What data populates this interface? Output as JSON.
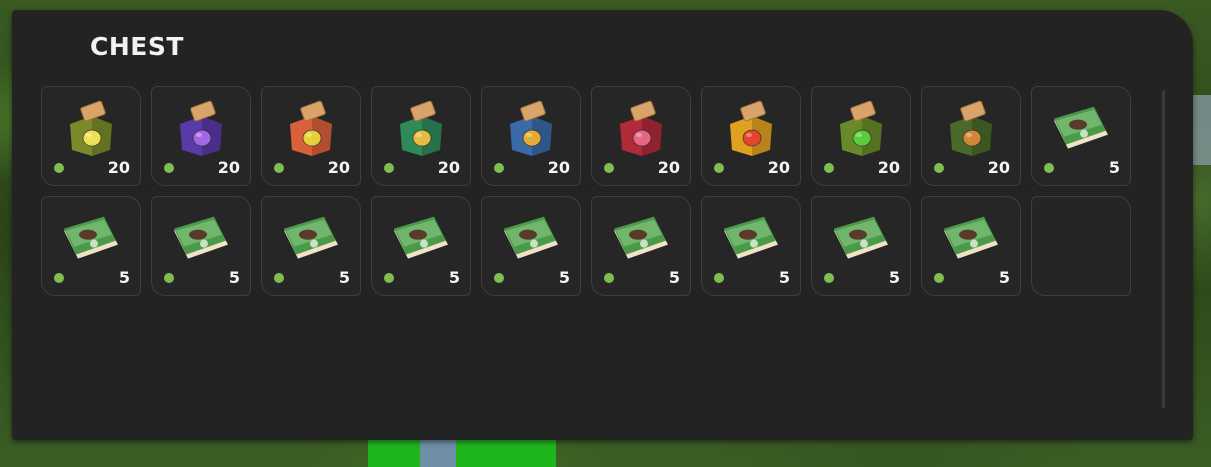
{
  "chest": {
    "title": "CHEST",
    "slots": [
      {
        "icon": "seed-bag-banana-icon",
        "color": "#7a8a2a",
        "fruit": "#f4e65a",
        "count": "20"
      },
      {
        "icon": "seed-bag-grape-icon",
        "color": "#5a3aa8",
        "fruit": "#a86ae8",
        "count": "20"
      },
      {
        "icon": "seed-bag-lemon-icon",
        "color": "#d8603a",
        "fruit": "#e8d83a",
        "count": "20"
      },
      {
        "icon": "seed-bag-pineapple-icon",
        "color": "#2f8a5a",
        "fruit": "#f0c040",
        "count": "20"
      },
      {
        "icon": "seed-bag-carrot-icon",
        "color": "#3a6aa8",
        "fruit": "#f0b030",
        "count": "20"
      },
      {
        "icon": "seed-bag-radish-icon",
        "color": "#b02a3a",
        "fruit": "#e86a8a",
        "count": "20"
      },
      {
        "icon": "seed-bag-tomato-icon",
        "color": "#e0a020",
        "fruit": "#e84030",
        "count": "20"
      },
      {
        "icon": "seed-bag-broccoli-icon",
        "color": "#6a8a2a",
        "fruit": "#5ad040",
        "count": "20"
      },
      {
        "icon": "seed-bag-potato-icon",
        "color": "#4a6a2a",
        "fruit": "#d88a3a",
        "count": "20"
      },
      {
        "icon": "seed-packet-icon",
        "color": "#4a9a4a",
        "fruit": "#5a3a2a",
        "count": "5"
      },
      {
        "icon": "seed-packet-icon",
        "color": "#4a9a4a",
        "fruit": "#5a3a2a",
        "count": "5"
      },
      {
        "icon": "seed-packet-icon",
        "color": "#4a9a4a",
        "fruit": "#5a3a2a",
        "count": "5"
      },
      {
        "icon": "seed-packet-icon",
        "color": "#4a9a4a",
        "fruit": "#5a3a2a",
        "count": "5"
      },
      {
        "icon": "seed-packet-icon",
        "color": "#4a9a4a",
        "fruit": "#5a3a2a",
        "count": "5"
      },
      {
        "icon": "seed-packet-icon",
        "color": "#4a9a4a",
        "fruit": "#5a3a2a",
        "count": "5"
      },
      {
        "icon": "seed-packet-icon",
        "color": "#4a9a4a",
        "fruit": "#5a3a2a",
        "count": "5"
      },
      {
        "icon": "seed-packet-icon",
        "color": "#4a9a4a",
        "fruit": "#5a3a2a",
        "count": "5"
      },
      {
        "icon": "seed-packet-icon",
        "color": "#4a9a4a",
        "fruit": "#5a3a2a",
        "count": "5"
      },
      {
        "icon": "seed-packet-icon",
        "color": "#4a9a4a",
        "fruit": "#5a3a2a",
        "count": "5"
      },
      {
        "icon": "",
        "color": "",
        "fruit": "",
        "count": ""
      }
    ]
  },
  "colors": {
    "panel_bg": "#232323",
    "slot_border": "#3e3e3e",
    "status_dot": "#7fbf4f",
    "title_text": "#f2f2f2"
  }
}
